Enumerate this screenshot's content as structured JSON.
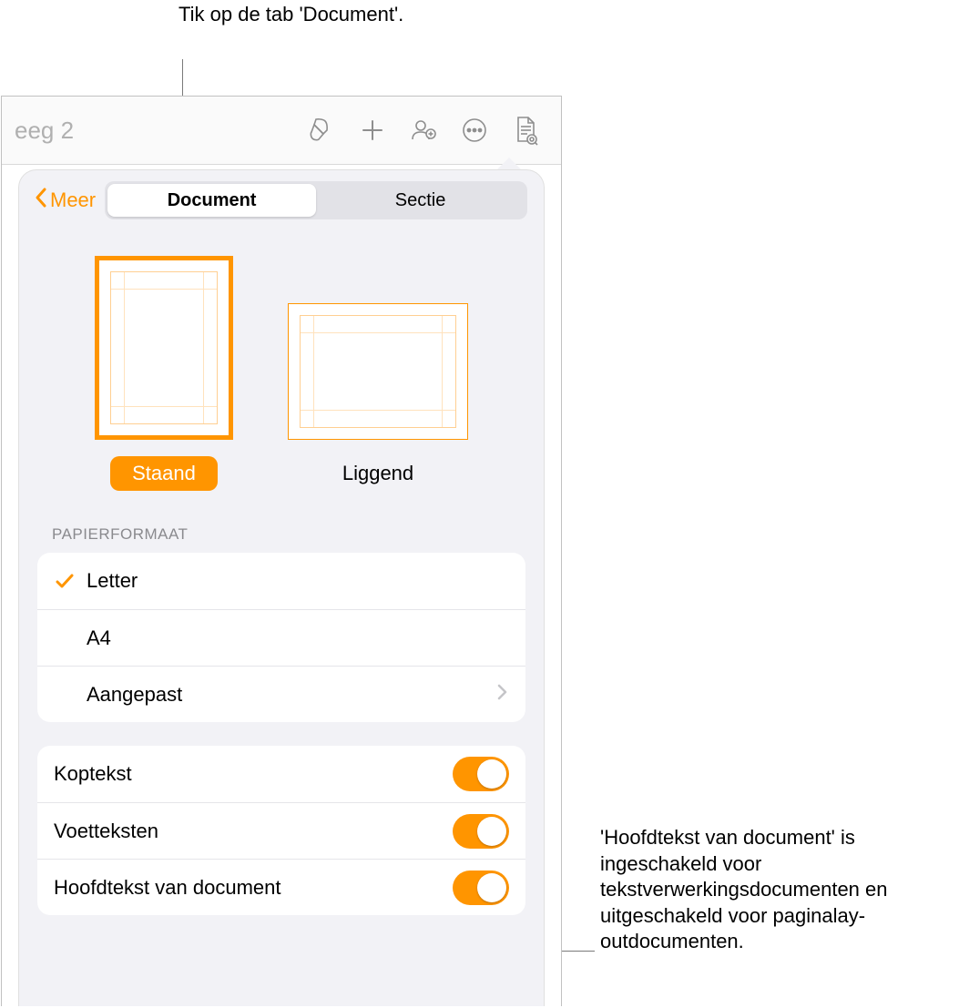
{
  "callouts": {
    "top": "Tik op de tab 'Document'.",
    "right": "'Hoofdtekst van document' is ingeschakeld voor tekstverwerkingsdocumenten en uitgeschakeld voor paginalay-outdocumenten."
  },
  "toolbar": {
    "doc_title_fragment": "eeg 2"
  },
  "popover": {
    "back_label": "Meer",
    "tabs": {
      "document": "Document",
      "section": "Sectie"
    },
    "orientation": {
      "portrait_label": "Staand",
      "landscape_label": "Liggend"
    },
    "paper_section_header": "PAPIERFORMAAT",
    "paper_sizes": {
      "letter": "Letter",
      "a4": "A4",
      "custom": "Aangepast"
    },
    "toggles": {
      "header": "Koptekst",
      "footers": "Voetteksten",
      "body": "Hoofdtekst van document"
    }
  }
}
